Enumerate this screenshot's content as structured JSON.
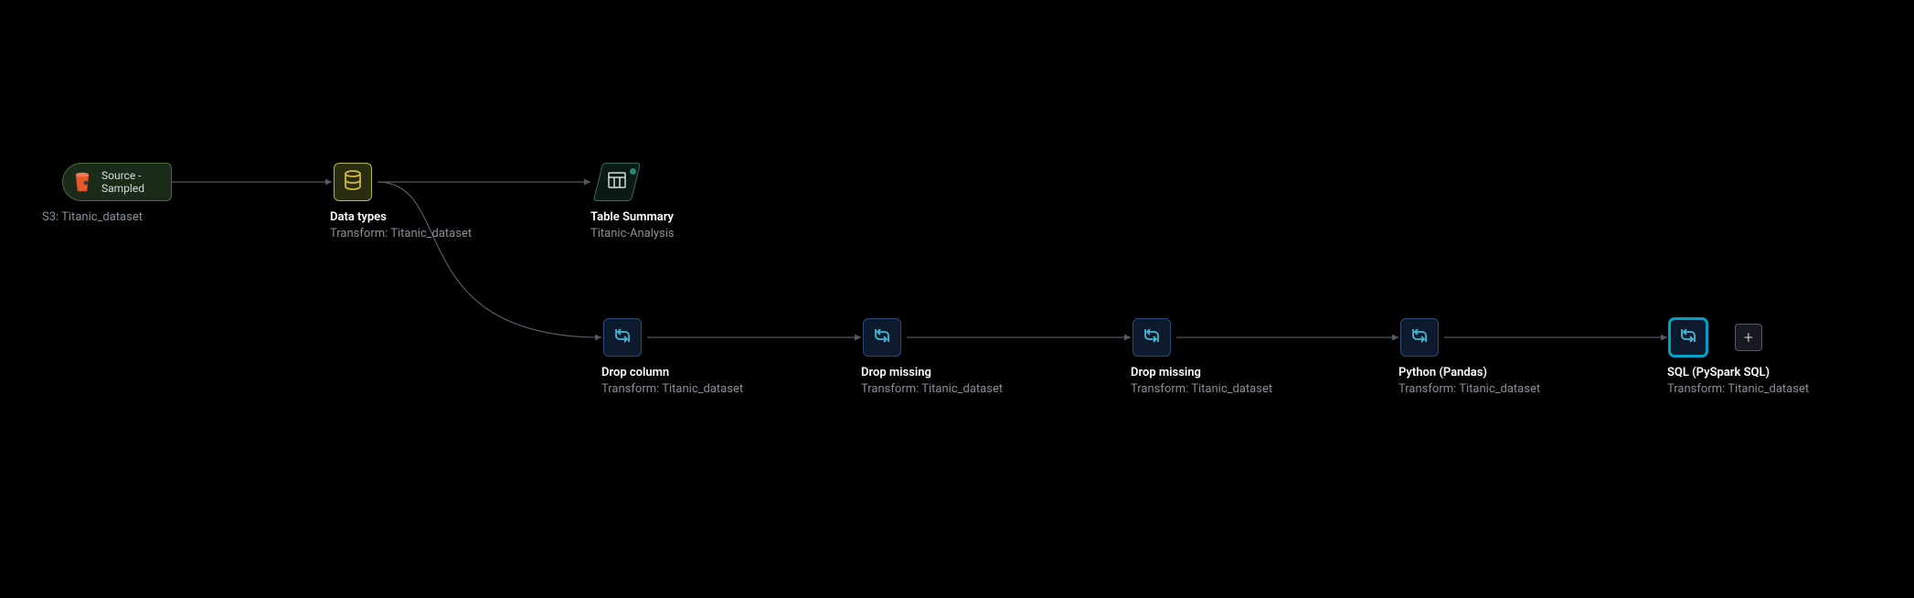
{
  "nodes": {
    "source": {
      "label": "Source - Sampled",
      "sub": "S3: Titanic_dataset"
    },
    "datatypes": {
      "title": "Data types",
      "sub": "Transform: Titanic_dataset"
    },
    "summary": {
      "title": "Table Summary",
      "sub": "Titanic-Analysis"
    },
    "t1": {
      "title": "Drop column",
      "sub": "Transform: Titanic_dataset"
    },
    "t2": {
      "title": "Drop missing",
      "sub": "Transform: Titanic_dataset"
    },
    "t3": {
      "title": "Drop missing",
      "sub": "Transform: Titanic_dataset"
    },
    "t4": {
      "title": "Python (Pandas)",
      "sub": "Transform: Titanic_dataset"
    },
    "t5": {
      "title": "SQL (PySpark SQL)",
      "sub": "Transform: Titanic_dataset"
    }
  },
  "icons": {
    "plus": "+"
  }
}
